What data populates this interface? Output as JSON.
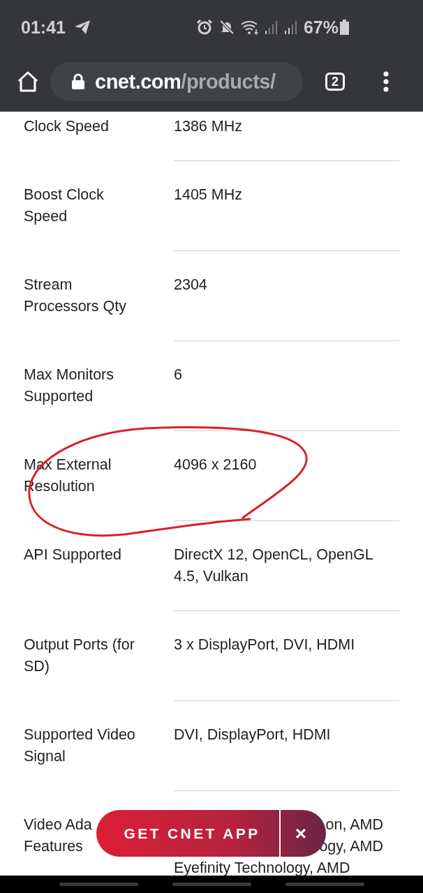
{
  "status_bar": {
    "time": "01:41",
    "battery_text": "67%"
  },
  "toolbar": {
    "url_host": "cnet.com",
    "url_path": "/products/",
    "tab_count": "2"
  },
  "specs": [
    {
      "kind": "full",
      "label": "Clock Speed",
      "value": "1386 MHz"
    },
    {
      "kind": "full",
      "label": "Boost Clock Speed",
      "value": "1405 MHz"
    },
    {
      "kind": "full",
      "label": "Stream Processors Qty",
      "value": "2304"
    },
    {
      "kind": "full",
      "label": "Max Monitors Supported",
      "value": "6"
    },
    {
      "kind": "full",
      "label": "Max External Resolution",
      "value": "4096 x 2160"
    },
    {
      "kind": "full",
      "label": "API Supported",
      "value": "DirectX 12, OpenCL, OpenGL 4.5, Vulkan"
    },
    {
      "kind": "full",
      "label": "Output Ports (for SD)",
      "value": "3 x DisplayPort, DVI, HDMI"
    },
    {
      "kind": "full",
      "label": "Supported Video Signal",
      "value": "DVI, DisplayPort, HDMI"
    },
    {
      "kind": "covered",
      "label_lines": [
        "Video Ada",
        "Features"
      ],
      "value_lines": [
        "on, AMD",
        "ogy, AMD",
        "Eyefinity Technology, AMD"
      ]
    }
  ],
  "app_banner": {
    "label": "GET CNET APP",
    "close": "×"
  }
}
